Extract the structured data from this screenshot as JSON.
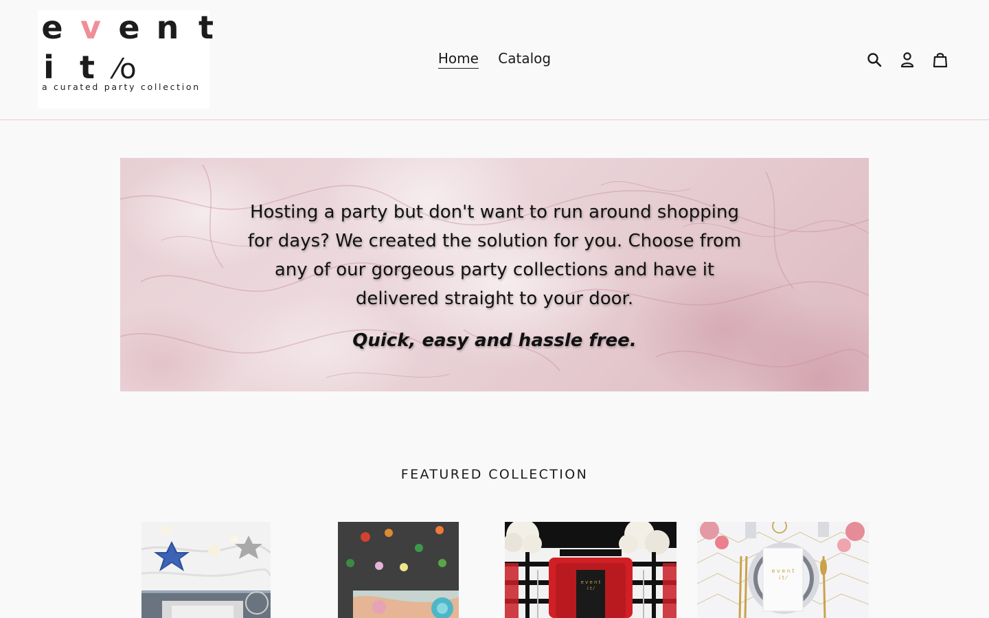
{
  "brand": {
    "logo_row1": [
      "e",
      "v",
      "e",
      "n",
      "t"
    ],
    "logo_row2": [
      "i",
      "t",
      "⁄o"
    ],
    "tagline": "a curated party collection",
    "accent_color": "#ef8e97"
  },
  "nav": {
    "items": [
      {
        "label": "Home",
        "active": true
      },
      {
        "label": "Catalog",
        "active": false
      }
    ]
  },
  "header_icons": [
    "search-icon",
    "account-icon",
    "cart-icon"
  ],
  "hero": {
    "text": "Hosting a party but don't want to run around shopping for days? We created the solution for you. Choose from any of our gorgeous party collections and have it delivered straight to your door.",
    "tagline": "Quick, easy and hassle free."
  },
  "featured": {
    "title": "FEATURED COLLECTION"
  },
  "colors": {
    "background": "#f9f9f9",
    "header_border": "#e9c9d0",
    "hero_pink": "#e7cfd4",
    "text": "#1a1a1a"
  }
}
